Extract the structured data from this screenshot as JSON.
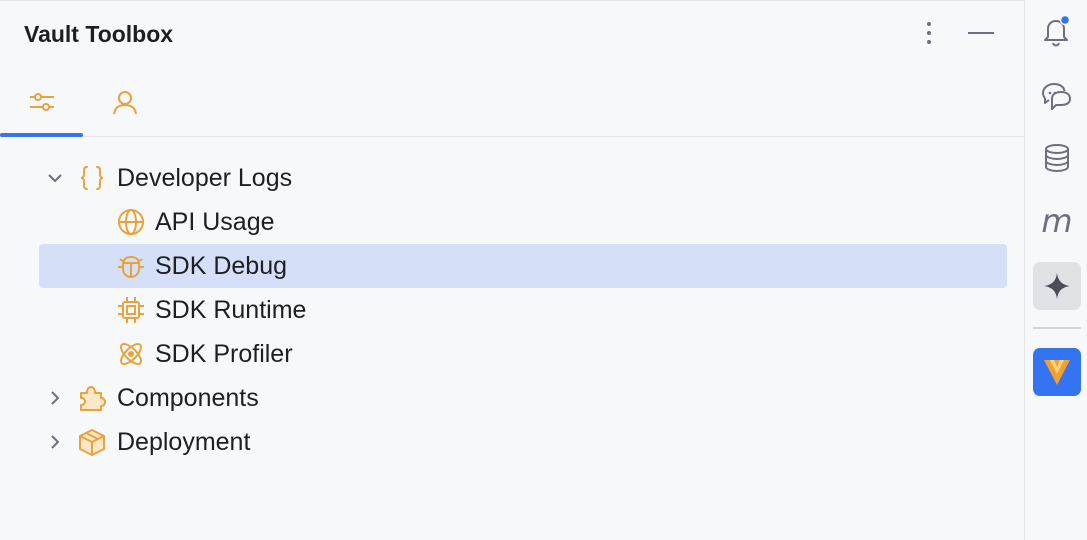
{
  "panel": {
    "title": "Vault Toolbox",
    "options_icon": "vertical-ellipsis-icon",
    "minimize_icon": "minimize-icon"
  },
  "tabs": [
    {
      "icon": "sliders-icon",
      "active": true
    },
    {
      "icon": "user-icon",
      "active": false
    }
  ],
  "tree": {
    "items": [
      {
        "label": "Developer Logs",
        "icon": "braces-icon",
        "expanded": true
      },
      {
        "label": "API Usage",
        "icon": "globe-icon"
      },
      {
        "label": "SDK Debug",
        "icon": "bug-icon",
        "selected": true
      },
      {
        "label": "SDK Runtime",
        "icon": "chip-icon"
      },
      {
        "label": "SDK Profiler",
        "icon": "atom-icon"
      },
      {
        "label": "Components",
        "icon": "puzzle-icon",
        "expanded": false
      },
      {
        "label": "Deployment",
        "icon": "package-icon",
        "expanded": false
      }
    ]
  },
  "right_rail": [
    {
      "icon": "notifications-bell-icon",
      "badge": true
    },
    {
      "icon": "chat-bubbles-icon"
    },
    {
      "icon": "database-icon"
    },
    {
      "icon": "m-letter-icon",
      "text": "m"
    },
    {
      "icon": "sparkle-icon",
      "active": true
    },
    {
      "icon": "vault-logo-icon"
    }
  ],
  "colors": {
    "accent": "#3574f0",
    "icon_orange": "#e8a33d",
    "selection": "#d5e0f8",
    "notification_badge": "#3574f0"
  }
}
